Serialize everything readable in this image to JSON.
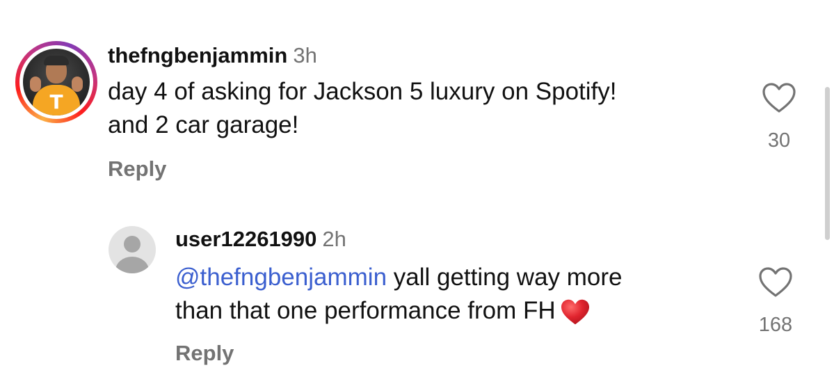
{
  "comments": [
    {
      "username": "thefngbenjammin",
      "time": "3h",
      "text_lines": [
        "day 4 of asking for Jackson 5 luxury on Spotify!",
        "and 2 car garage!"
      ],
      "reply_label": "Reply",
      "likes": "30",
      "avatar": "profile-photo-story-ring"
    },
    {
      "username": "user12261990",
      "time": "2h",
      "mention": "@thefngbenjammin",
      "text_line1_rest": " yall getting way more",
      "text_line2": "than that one performance from FH",
      "emoji": "red-heart",
      "reply_label": "Reply",
      "likes": "168",
      "avatar": "default-avatar"
    }
  ],
  "colors": {
    "mention": "#3b5fcf",
    "secondary_text": "#737373",
    "heart_emoji": "#e0242e"
  },
  "icons": [
    "heart-outline-icon",
    "red-heart-emoji"
  ]
}
